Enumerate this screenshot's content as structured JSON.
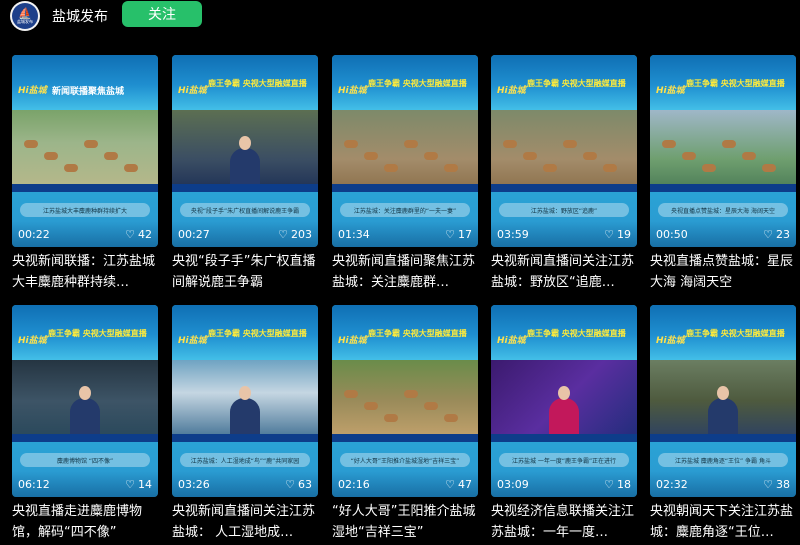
{
  "account": {
    "avatar_symbol": "⛵",
    "avatar_caption": "盐城发布",
    "name": "盐城发布",
    "follow_label": "关注"
  },
  "videos": [
    {
      "duration": "00:22",
      "likes": "42",
      "title": "央视新闻联播：江苏盐城大丰麋鹿种群持续…",
      "banner": "新闻联播聚焦盐城",
      "caption": "江苏盐城大丰麋鹿种群持续扩大",
      "scene": "field"
    },
    {
      "duration": "00:27",
      "likes": "203",
      "title": "央视“段子手”朱广权直播间解说鹿王争霸",
      "banner": "鹿王争霸 央视大型融媒直播",
      "caption": "央视“段子手”朱广权直播间解说鹿王争霸",
      "scene": "anchor"
    },
    {
      "duration": "01:34",
      "likes": "17",
      "title": "央视新闻直播间聚焦江苏盐城：关注麋鹿群…",
      "banner": "鹿王争霸 央视大型融媒直播",
      "caption": "江苏盐城：关注麋鹿群里的“一夫一妻”",
      "scene": "deer"
    },
    {
      "duration": "03:59",
      "likes": "19",
      "title": "央视新闻直播间关注江苏盐城：野放区“追鹿…",
      "banner": "鹿王争霸 央视大型融媒直播",
      "caption": "江苏盐城：野放区“追鹿”",
      "scene": "deer"
    },
    {
      "duration": "00:50",
      "likes": "23",
      "title": "央视直播点赞盐城：星辰大海 海阔天空",
      "banner": "鹿王争霸 央视大型融媒直播",
      "caption": "央视直播点赞盐城：星辰大海 海阔天空",
      "scene": "lake"
    },
    {
      "duration": "06:12",
      "likes": "14",
      "title": "央视直播走进麋鹿博物馆，解码“四不像”",
      "banner": "鹿王争霸 央视大型融媒直播",
      "caption": "麋鹿博物馆 “四不像”",
      "scene": "museum"
    },
    {
      "duration": "03:26",
      "likes": "63",
      "title": "央视新闻直播间关注江苏盐城： 人工湿地成…",
      "banner": "鹿王争霸 央视大型融媒直播",
      "caption": "江苏盐城：人工湿地成“鸟”“鹿”共同家园",
      "scene": "studio"
    },
    {
      "duration": "02:16",
      "likes": "47",
      "title": "“好人大哥”王阳推介盐城湿地“吉祥三宝”",
      "banner": "鹿王争霸 央视大型融媒直播",
      "caption": "“好人大哥”王阳推介盐城湿地“吉祥三宝”",
      "scene": "outdoor"
    },
    {
      "duration": "03:09",
      "likes": "18",
      "title": "央视经济信息联播关注江苏盐城：一年一度…",
      "banner": "鹿王争霸 央视大型融媒直播",
      "caption": "江苏盐城 一年一度“鹿王争霸”正在进行",
      "scene": "purple"
    },
    {
      "duration": "02:32",
      "likes": "38",
      "title": "央视朝闻天下关注江苏盐城：麋鹿角逐“王位…",
      "banner": "鹿王争霸 央视大型融媒直播",
      "caption": "江苏盐城 麋鹿角逐“王位” 争霸 角斗",
      "scene": "desk"
    }
  ]
}
